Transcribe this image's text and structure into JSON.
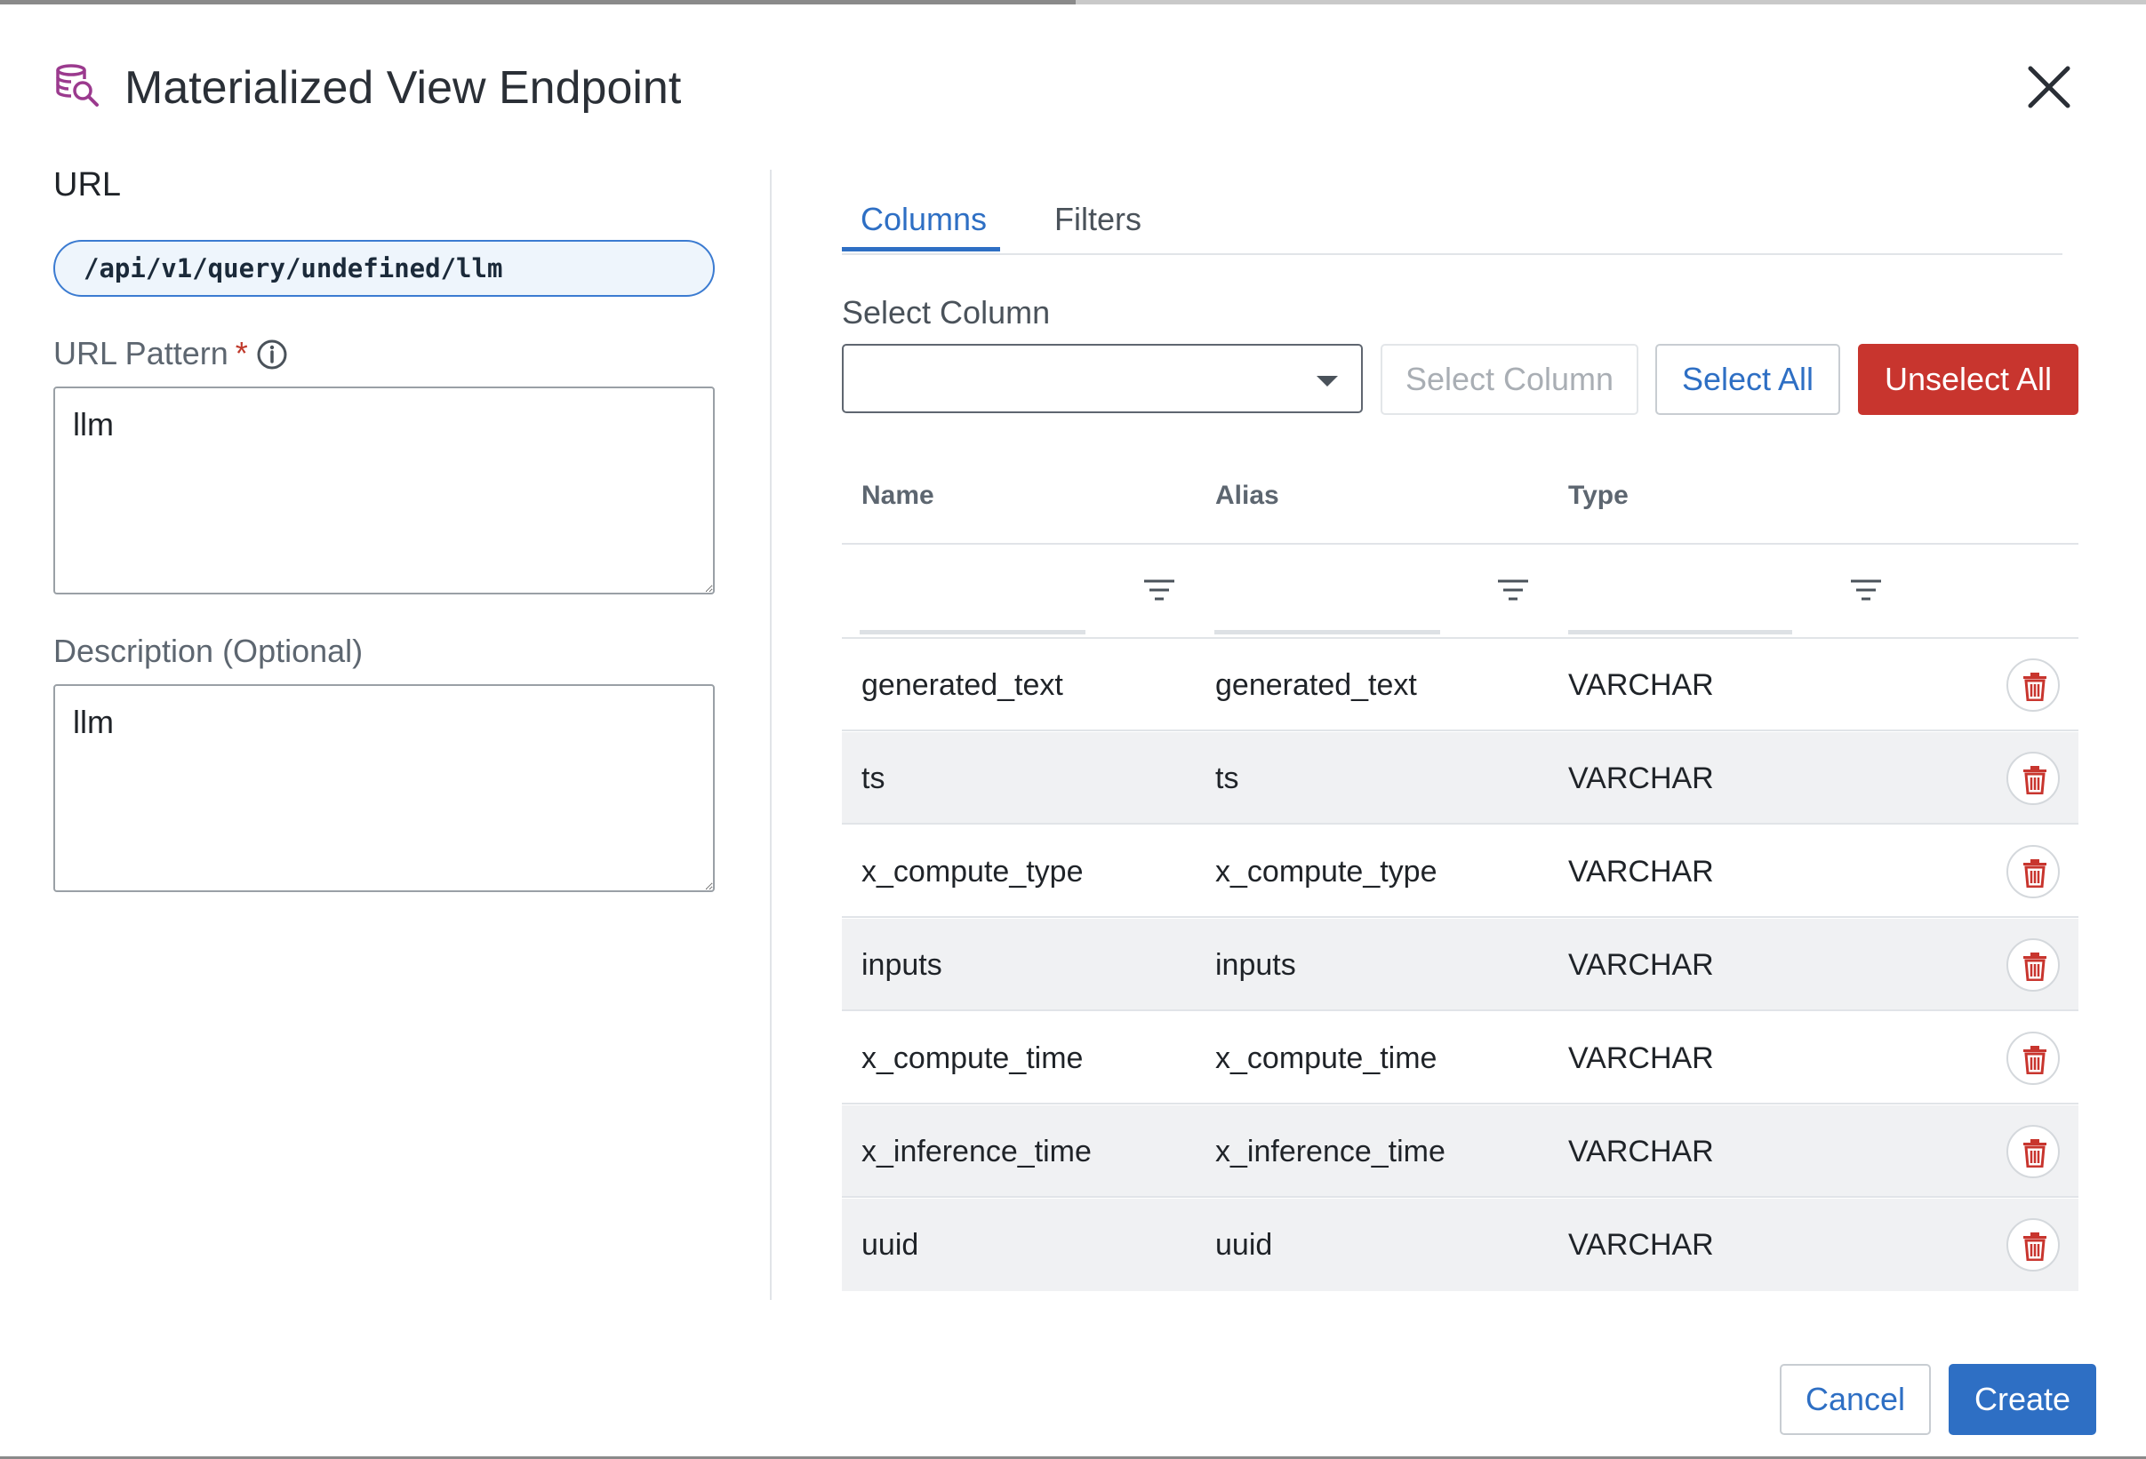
{
  "dialog": {
    "title": "Materialized View Endpoint",
    "icon": "database-search-icon",
    "close_icon": "close-icon"
  },
  "left": {
    "url_label": "URL",
    "url_value": "/api/v1/query/undefined/llm",
    "pattern_label": "URL Pattern",
    "pattern_required_mark": "*",
    "pattern_value": "llm",
    "description_label": "Description (Optional)",
    "description_value": "llm"
  },
  "tabs": [
    {
      "label": "Columns",
      "active": true
    },
    {
      "label": "Filters",
      "active": false
    }
  ],
  "column_picker": {
    "label": "Select Column",
    "selected_value": "",
    "select_button": "Select Column",
    "select_all_button": "Select All",
    "unselect_all_button": "Unselect All"
  },
  "table": {
    "headers": [
      "Name",
      "Alias",
      "Type"
    ],
    "rows": [
      {
        "name": "generated_text",
        "alias": "generated_text",
        "type": "VARCHAR"
      },
      {
        "name": "ts",
        "alias": "ts",
        "type": "VARCHAR"
      },
      {
        "name": "x_compute_type",
        "alias": "x_compute_type",
        "type": "VARCHAR"
      },
      {
        "name": "inputs",
        "alias": "inputs",
        "type": "VARCHAR"
      },
      {
        "name": "x_compute_time",
        "alias": "x_compute_time",
        "type": "VARCHAR"
      },
      {
        "name": "x_inference_time",
        "alias": "x_inference_time",
        "type": "VARCHAR"
      },
      {
        "name": "uuid",
        "alias": "uuid",
        "type": "VARCHAR"
      }
    ]
  },
  "footer": {
    "cancel": "Cancel",
    "create": "Create"
  },
  "colors": {
    "accent": "#2e6fc4",
    "danger": "#c8352e",
    "icon_magenta": "#9b3a8e"
  }
}
